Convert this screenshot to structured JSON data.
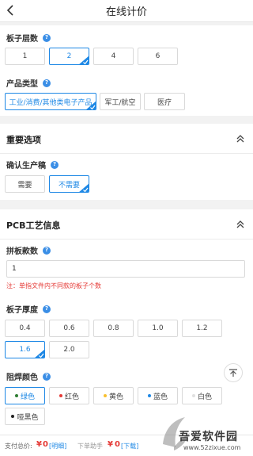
{
  "header": {
    "title": "在线计价"
  },
  "layers": {
    "label": "板子层数",
    "options": [
      "1",
      "2",
      "4",
      "6"
    ],
    "selected": "2"
  },
  "product_type": {
    "label": "产品类型",
    "options": [
      "工业/消费/其他类电子产品",
      "军工/航空",
      "医疗"
    ],
    "selected": "工业/消费/其他类电子产品"
  },
  "important": {
    "title": "重要选项",
    "confirm_label": "确认生产稿",
    "options": [
      "需要",
      "不需要"
    ],
    "selected": "不需要"
  },
  "pcb": {
    "title": "PCB工艺信息",
    "panel_label": "拼板款数",
    "panel_value": "1",
    "panel_note": "注：单指文件内不同款的板子个数",
    "thickness_label": "板子厚度",
    "thickness_options": [
      "0.4",
      "0.6",
      "0.8",
      "1.0",
      "1.2",
      "1.6",
      "2.0"
    ],
    "thickness_selected": "1.6",
    "mask_label": "阻焊颜色",
    "mask_options": [
      {
        "label": "绿色",
        "color": "#2e7d32"
      },
      {
        "label": "红色",
        "color": "#e53935"
      },
      {
        "label": "黄色",
        "color": "#f9c02e"
      },
      {
        "label": "蓝色",
        "color": "#1e88e5"
      },
      {
        "label": "白色",
        "color": "#e0e0e0"
      },
      {
        "label": "哑黑色",
        "color": "#222222"
      }
    ],
    "mask_selected": "绿色"
  },
  "footer": {
    "total_label": "支付总价:",
    "total_currency": "¥",
    "total_value": "0",
    "detail_link": "[明细]",
    "assist_label": "下单助手",
    "assist_currency": "¥",
    "assist_value": "0",
    "download_link": "[下载]"
  },
  "watermark": {
    "name": "吾爱软件园",
    "url": "www.52zixue.com"
  },
  "colors": {
    "accent": "#1e88e5",
    "warning": "#e53935"
  }
}
